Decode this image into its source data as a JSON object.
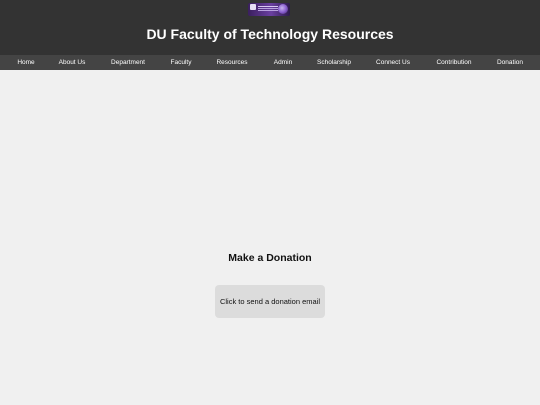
{
  "header": {
    "logo": "du-faculty-of-technology-logo",
    "title": "DU Faculty of Technology Resources"
  },
  "nav": {
    "items": [
      "Home",
      "About Us",
      "Department",
      "Faculty",
      "Resources",
      "Admin",
      "Scholarship",
      "Connect Us",
      "Contribution",
      "Donation"
    ]
  },
  "main": {
    "heading": "Make a Donation",
    "button_label": "Click to send a donation email"
  },
  "colors": {
    "header_bg": "#333333",
    "nav_bg": "#444444",
    "page_bg": "#f0f0f0",
    "button_bg": "#dcdcdc"
  }
}
